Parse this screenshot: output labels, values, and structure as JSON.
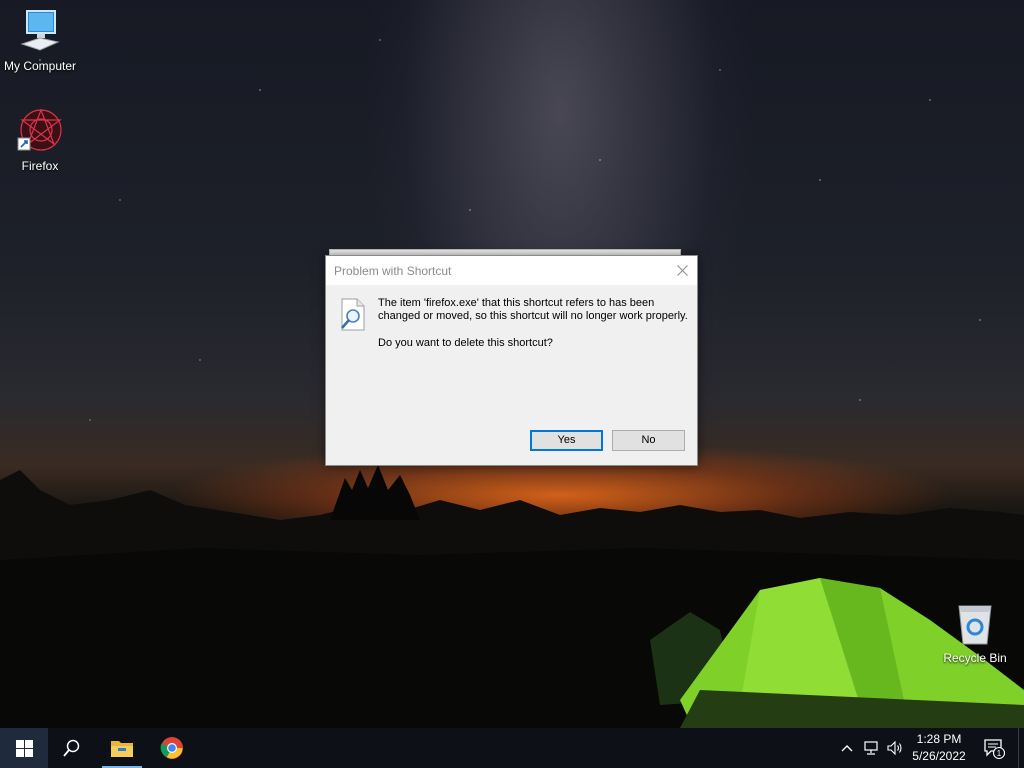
{
  "desktop": {
    "icons": [
      {
        "label": "My Computer",
        "icon": "computer-icon"
      },
      {
        "label": "Firefox",
        "icon": "firefox-shortcut-icon"
      },
      {
        "label": "Recycle Bin",
        "icon": "recycle-bin-icon"
      }
    ]
  },
  "dialog": {
    "title": "Problem with Shortcut",
    "message": "The item 'firefox.exe' that this shortcut refers to has been changed or moved, so this shortcut will no longer work properly.",
    "question": "Do you want to delete this shortcut?",
    "yes_label": "Yes",
    "no_label": "No",
    "icon": "search-document-icon"
  },
  "taskbar": {
    "pinned": [
      "windows-start-icon",
      "search-icon",
      "file-explorer-icon",
      "chrome-icon"
    ],
    "tray_icons": [
      "chevron-up-icon",
      "network-icon",
      "volume-icon"
    ],
    "time": "1:28 PM",
    "date": "5/26/2022",
    "notification_count": "1",
    "accent_color": "#0078d7"
  }
}
